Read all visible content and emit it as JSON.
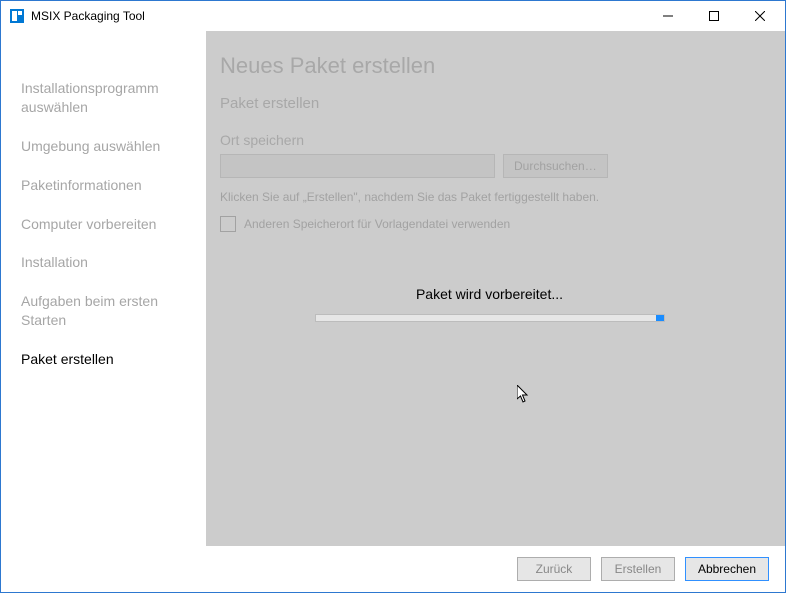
{
  "titlebar": {
    "title": "MSIX Packaging Tool"
  },
  "sidebar": {
    "items": [
      {
        "label": "Installationsprogramm auswählen",
        "active": false
      },
      {
        "label": "Umgebung auswählen",
        "active": false
      },
      {
        "label": "Paketinformationen",
        "active": false
      },
      {
        "label": "Computer vorbereiten",
        "active": false
      },
      {
        "label": "Installation",
        "active": false
      },
      {
        "label": "Aufgaben beim ersten Starten",
        "active": false
      },
      {
        "label": "Paket erstellen",
        "active": true
      }
    ]
  },
  "main": {
    "page_title": "Neues Paket erstellen",
    "section_title": "Paket erstellen",
    "save_location_label": "Ort speichern",
    "save_location_value": "",
    "browse_label": "Durchsuchen…",
    "hint": "Klicken Sie auf „Erstellen\", nachdem Sie das Paket fertiggestellt haben.",
    "checkbox_label": "Anderen Speicherort für Vorlagendatei verwenden",
    "checkbox_checked": false,
    "progress_label": "Paket wird vorbereitet..."
  },
  "footer": {
    "back": "Zurück",
    "create": "Erstellen",
    "cancel": "Abbrechen"
  }
}
